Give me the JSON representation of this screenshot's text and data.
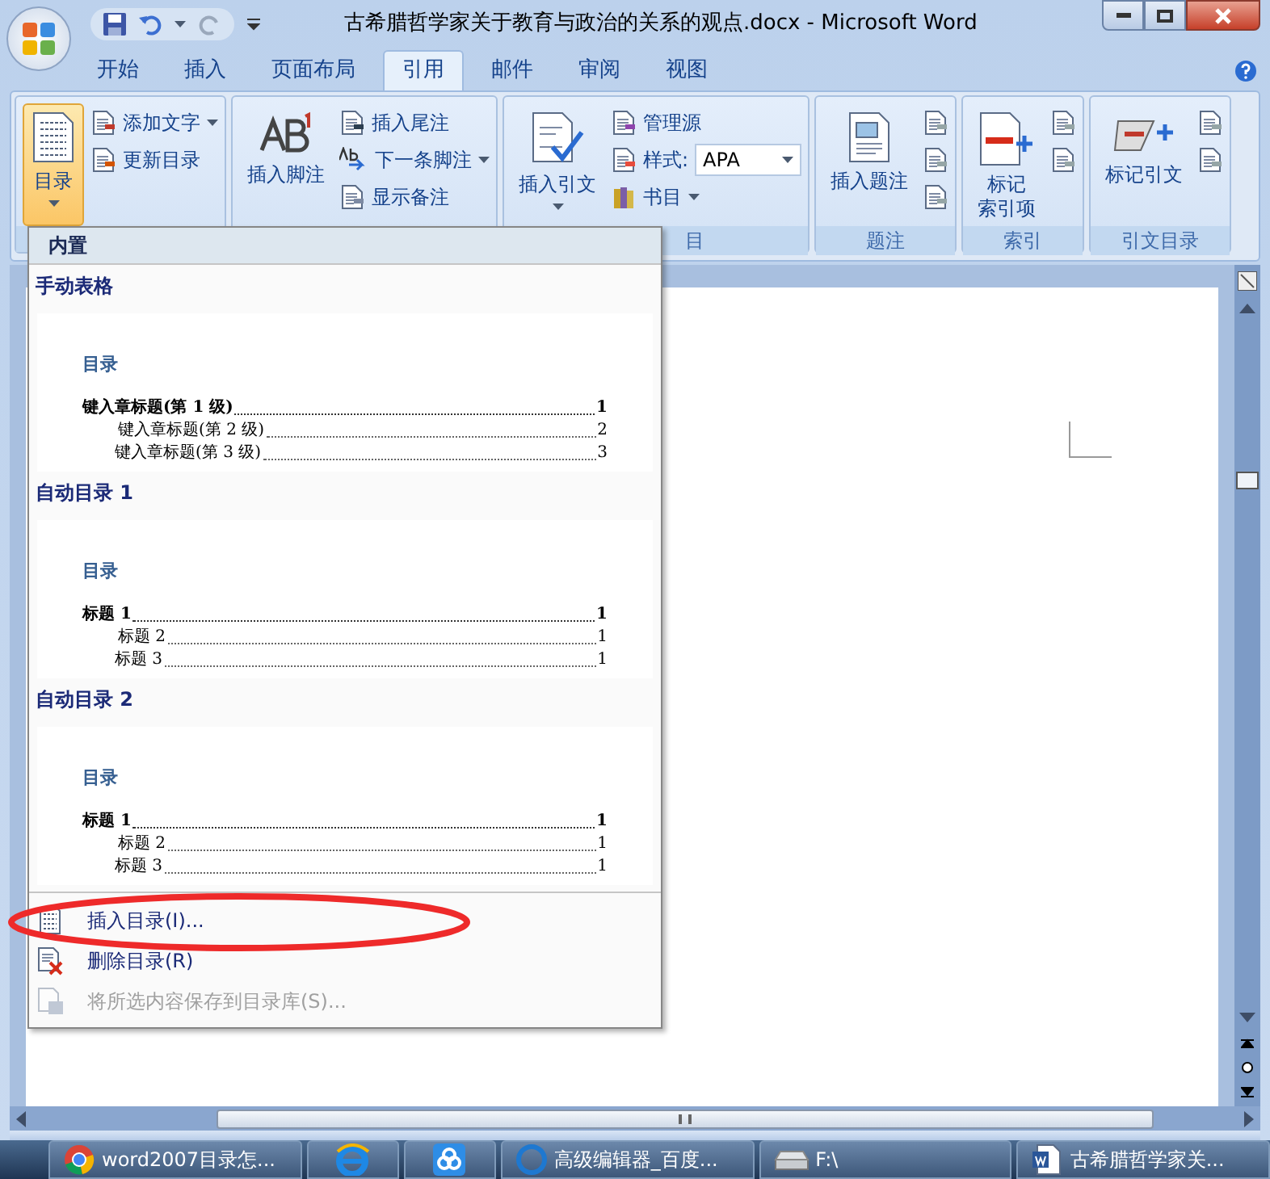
{
  "window": {
    "title": "古希腊哲学家关于教育与政治的关系的观点.docx - Microsoft Word"
  },
  "tabs": [
    {
      "label": "开始",
      "selected": false
    },
    {
      "label": "插入",
      "selected": false
    },
    {
      "label": "页面布局",
      "selected": false
    },
    {
      "label": "引用",
      "selected": true
    },
    {
      "label": "邮件",
      "selected": false
    },
    {
      "label": "审阅",
      "selected": false
    },
    {
      "label": "视图",
      "selected": false
    }
  ],
  "ribbon": {
    "groups": [
      {
        "large": {
          "label_lines": [
            "目录"
          ],
          "dropdown": true,
          "selected": true,
          "kind": "toc"
        },
        "smalls": [
          {
            "label": "添加文字",
            "dropdown": true,
            "kind": "add"
          },
          {
            "label": "更新目录",
            "dropdown": false,
            "kind": "update"
          }
        ]
      },
      {
        "large": {
          "label_lines": [
            "插入脚注"
          ],
          "dropdown": false,
          "selected": false,
          "kind": "footnote"
        },
        "smalls": [
          {
            "label": "插入尾注",
            "dropdown": false,
            "kind": "endnote"
          },
          {
            "label": "下一条脚注",
            "dropdown": true,
            "kind": "next"
          },
          {
            "label": "显示备注",
            "dropdown": false,
            "kind": "notes"
          }
        ]
      },
      {
        "large": {
          "label_lines": [
            "插入引文"
          ],
          "dropdown": true,
          "selected": false,
          "kind": "citation"
        },
        "smalls": [
          {
            "label": "管理源",
            "dropdown": false,
            "kind": "sources"
          },
          {
            "label": "样式:",
            "value": "APA",
            "kind": "style"
          },
          {
            "label": "书目",
            "dropdown": true,
            "kind": "bibliography"
          }
        ],
        "label": "目"
      },
      {
        "large": {
          "label_lines": [
            "插入题注"
          ],
          "dropdown": false,
          "selected": false,
          "kind": "caption"
        },
        "smalls": [
          {
            "kind": "icon"
          },
          {
            "kind": "icon"
          },
          {
            "kind": "icon"
          }
        ],
        "label": "题注"
      },
      {
        "large": {
          "label_lines": [
            "标记",
            "索引项"
          ],
          "dropdown": false,
          "selected": false,
          "kind": "index"
        },
        "smalls": [
          {
            "kind": "icon"
          },
          {
            "kind": "icon"
          }
        ],
        "label": "索引"
      },
      {
        "large": {
          "label_lines": [
            "标记引文"
          ],
          "dropdown": false,
          "selected": false,
          "kind": "mark"
        },
        "smalls": [
          {
            "kind": "icon"
          },
          {
            "kind": "icon"
          }
        ],
        "label": "引文目录"
      }
    ]
  },
  "toc_menu": {
    "header": "内置",
    "sections": [
      {
        "title": "手动表格",
        "preview_heading": "目录",
        "entries": [
          {
            "text": "键入章标题(第 1 级)",
            "page": "1",
            "kind": "level1"
          },
          {
            "text": "键入章标题(第 2 级)",
            "page": "2",
            "kind": "level2"
          },
          {
            "text": "键入章标题(第 3 级)",
            "page": "3",
            "kind": "level3"
          }
        ]
      },
      {
        "title": "自动目录 1",
        "preview_heading": "目录",
        "entries": [
          {
            "text": "标题 1",
            "page": "1",
            "kind": "level1"
          },
          {
            "text": "标题 2",
            "page": "1",
            "kind": "level2"
          },
          {
            "text": "标题 3",
            "page": "1",
            "kind": "level3"
          }
        ]
      },
      {
        "title": "自动目录 2",
        "preview_heading": "目录",
        "entries": [
          {
            "text": "标题 1",
            "page": "1",
            "kind": "level1"
          },
          {
            "text": "标题 2",
            "page": "1",
            "kind": "level2"
          },
          {
            "text": "标题 3",
            "page": "1",
            "kind": "level3"
          }
        ]
      }
    ],
    "actions": [
      {
        "label": "插入目录(I)...",
        "disabled": false,
        "kind": "insert"
      },
      {
        "label": "删除目录(R)",
        "disabled": false,
        "kind": "delete"
      },
      {
        "label": "将所选内容保存到目录库(S)...",
        "disabled": true,
        "kind": "save"
      }
    ]
  },
  "taskbar": [
    {
      "label": "word2007目录怎...",
      "kind": "chrome"
    },
    {
      "kind": "ie"
    },
    {
      "kind": "app"
    },
    {
      "label": "高级编辑器_百度...",
      "kind": "browser"
    },
    {
      "label": "F:\\",
      "kind": "folder"
    },
    {
      "label": "古希腊哲学家关...",
      "kind": "word"
    }
  ]
}
